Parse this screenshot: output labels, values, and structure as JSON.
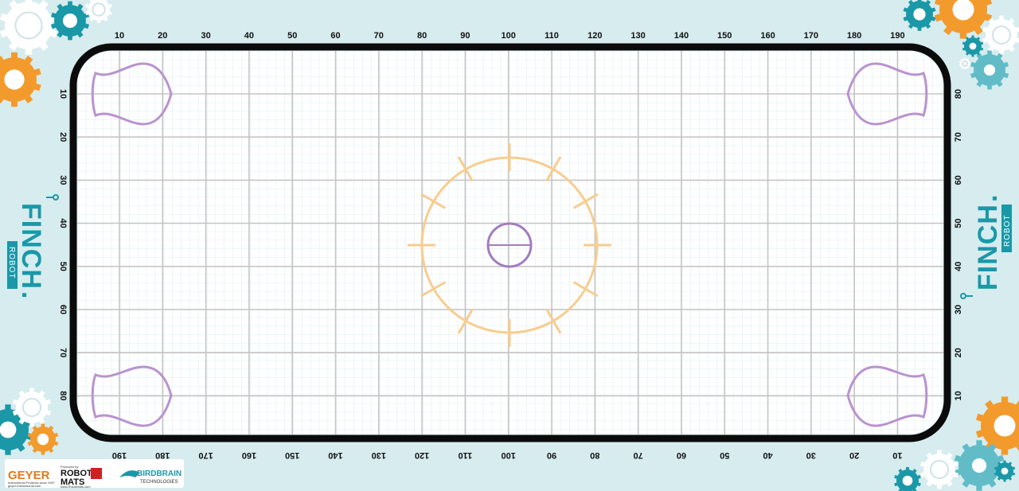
{
  "top_labels": [
    "10",
    "20",
    "30",
    "40",
    "50",
    "60",
    "70",
    "80",
    "90",
    "100",
    "110",
    "120",
    "130",
    "140",
    "150",
    "160",
    "170",
    "180",
    "190"
  ],
  "bottom_labels": [
    "190",
    "180",
    "170",
    "160",
    "150",
    "140",
    "130",
    "120",
    "110",
    "100",
    "90",
    "80",
    "70",
    "60",
    "50",
    "40",
    "30",
    "20",
    "10"
  ],
  "left_labels": [
    "10",
    "20",
    "30",
    "40",
    "50",
    "60",
    "70",
    "80"
  ],
  "right_labels": [
    "80",
    "70",
    "60",
    "50",
    "40",
    "30",
    "20",
    "10"
  ],
  "brand": {
    "finch": "FINCH",
    "robot": "ROBOT",
    "dot": "."
  },
  "sponsors": {
    "geyer": "GEYER",
    "geyer_tag": "Instructional Products since 1957",
    "geyer_url": "geyer-instructional.com",
    "robotmats_top": "ROBOT",
    "robotmats_bottom": "MATS",
    "robotmats_tag": "Produced by",
    "robotmats_url": "www.RobotMats.com",
    "birdbrain": "BIRDBRAIN",
    "birdbrain_sub": "TECHNOLOGIES"
  },
  "colors": {
    "background": "#d6ecef",
    "mat": "#ffffff",
    "border": "#0b0b0b",
    "grid_minor": "#d5e6ea",
    "grid_major": "#c9c9c9",
    "start_zone": "#b993cf",
    "target_ring": "#f7cd8e",
    "center_circle": "#a27cc0",
    "teal": "#1a98a8",
    "orange": "#f39a2c"
  }
}
